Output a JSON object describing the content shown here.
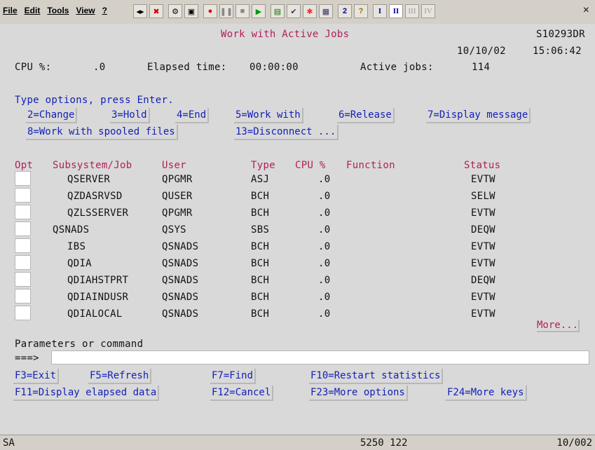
{
  "menu": [
    "File",
    "Edit",
    "Tools",
    "View",
    "?"
  ],
  "toolbar": {
    "icons": [
      "arrows-icon",
      "stop-x-icon",
      "macro-icon",
      "settings-icon",
      "record-icon",
      "pause-icon",
      "stop-icon",
      "play-icon",
      "screen-icon",
      "check-icon",
      "burst-icon",
      "grid-icon",
      "sysreq-icon",
      "help-icon",
      "session1-icon",
      "session2-icon",
      "session3-icon",
      "session4-icon"
    ],
    "session_labels": [
      "I",
      "II",
      "III",
      "IV"
    ]
  },
  "screen": {
    "title": "Work with Active Jobs",
    "system": "S10293DR",
    "date": "10/10/02",
    "time": "15:06:42",
    "cpu_label": "CPU %:",
    "cpu_value": ".0",
    "elapsed_label": "Elapsed time:",
    "elapsed_value": "00:00:00",
    "active_label": "Active jobs:",
    "active_value": "114",
    "instruction": "Type options, press Enter.",
    "options": [
      "2=Change",
      "3=Hold",
      "4=End",
      "5=Work with",
      "6=Release",
      "7=Display message",
      "8=Work with spooled files",
      "13=Disconnect ..."
    ],
    "columns": [
      "Opt",
      "Subsystem/Job",
      "User",
      "Type",
      "CPU %",
      "Function",
      "Status"
    ],
    "rows": [
      {
        "job": "QSERVER",
        "user": "QPGMR",
        "type": "ASJ",
        "cpu": ".0",
        "status": "EVTW"
      },
      {
        "job": "QZDASRVSD",
        "user": "QUSER",
        "type": "BCH",
        "cpu": ".0",
        "status": "SELW"
      },
      {
        "job": "QZLSSERVER",
        "user": "QPGMR",
        "type": "BCH",
        "cpu": ".0",
        "status": "EVTW"
      },
      {
        "job": "QSNADS",
        "user": "QSYS",
        "type": "SBS",
        "cpu": ".0",
        "status": "DEQW"
      },
      {
        "job": "IBS",
        "user": "QSNADS",
        "type": "BCH",
        "cpu": ".0",
        "status": "EVTW"
      },
      {
        "job": "QDIA",
        "user": "QSNADS",
        "type": "BCH",
        "cpu": ".0",
        "status": "EVTW"
      },
      {
        "job": "QDIAHSTPRT",
        "user": "QSNADS",
        "type": "BCH",
        "cpu": ".0",
        "status": "DEQW"
      },
      {
        "job": "QDIAINDUSR",
        "user": "QSNADS",
        "type": "BCH",
        "cpu": ".0",
        "status": "EVTW"
      },
      {
        "job": "QDIALOCAL",
        "user": "QSNADS",
        "type": "BCH",
        "cpu": ".0",
        "status": "EVTW"
      }
    ],
    "more": "More...",
    "params_label": "Parameters or command",
    "prompt": "===>",
    "command_value": "",
    "fkeys": [
      "F3=Exit",
      "F5=Refresh",
      "F7=Find",
      "F10=Restart statistics",
      "F11=Display elapsed data",
      "F12=Cancel",
      "F23=More options",
      "F24=More keys"
    ]
  },
  "status": {
    "left": "SA",
    "middle": "5250 122",
    "right": "10/002"
  }
}
